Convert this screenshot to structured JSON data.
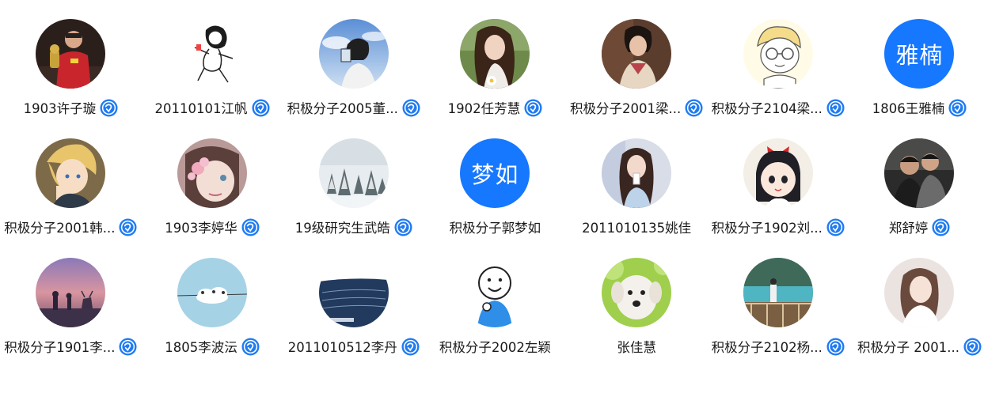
{
  "colors": {
    "badge_blue": "#1f7bf2",
    "initials_bg": "#1677ff",
    "name_text": "#1a1a1a"
  },
  "members": [
    {
      "name": "1903许子璇",
      "avatar": {
        "kind": "photo",
        "icon": "person-red-shirt-trophy"
      }
    },
    {
      "name": "20110101江帆",
      "avatar": {
        "kind": "photo",
        "icon": "cartoon-girl-sketch"
      }
    },
    {
      "name": "积极分子2005董...",
      "avatar": {
        "kind": "photo",
        "icon": "girl-blue-sky"
      }
    },
    {
      "name": "1902任芳慧",
      "avatar": {
        "kind": "photo",
        "icon": "girl-with-flower"
      }
    },
    {
      "name": "积极分子2001梁...",
      "avatar": {
        "kind": "photo",
        "icon": "girl-hanfu"
      }
    },
    {
      "name": "积极分子2104梁...",
      "avatar": {
        "kind": "photo",
        "icon": "cartoon-boy-glasses"
      }
    },
    {
      "name": "1806王雅楠",
      "avatar": {
        "kind": "initials",
        "text": "雅楠"
      }
    },
    {
      "name": "积极分子2001韩...",
      "avatar": {
        "kind": "photo",
        "icon": "anime-blond-boy"
      }
    },
    {
      "name": "1903李婷华",
      "avatar": {
        "kind": "photo",
        "icon": "illustrated-girl-flowers"
      }
    },
    {
      "name": "19级研究生武皓",
      "avatar": {
        "kind": "photo",
        "icon": "snowy-forest"
      }
    },
    {
      "name": "积极分子郭梦如",
      "avatar": {
        "kind": "initials",
        "text": "梦如"
      }
    },
    {
      "name": "2011010135姚佳",
      "avatar": {
        "kind": "photo",
        "icon": "girl-drinking"
      }
    },
    {
      "name": "积极分子1902刘...",
      "avatar": {
        "kind": "photo",
        "icon": "anime-girl-red-bow"
      }
    },
    {
      "name": "郑舒婷",
      "avatar": {
        "kind": "photo",
        "icon": "two-boys"
      }
    },
    {
      "name": "积极分子1901李...",
      "avatar": {
        "kind": "photo",
        "icon": "sunset-deer"
      }
    },
    {
      "name": "1805李波沄",
      "avatar": {
        "kind": "photo",
        "icon": "cloud-birds-wire"
      }
    },
    {
      "name": "2011010512李丹",
      "avatar": {
        "kind": "photo",
        "icon": "ocean-text"
      }
    },
    {
      "name": "积极分子2002左颖",
      "avatar": {
        "kind": "photo",
        "icon": "cartoon-smiley-person"
      }
    },
    {
      "name": "张佳慧",
      "avatar": {
        "kind": "photo",
        "icon": "white-puppy"
      }
    },
    {
      "name": "积极分子2102杨...",
      "avatar": {
        "kind": "photo",
        "icon": "lake-balcony"
      }
    },
    {
      "name": "积极分子 2001...",
      "avatar": {
        "kind": "photo",
        "icon": "girl-portrait-soft"
      }
    }
  ]
}
